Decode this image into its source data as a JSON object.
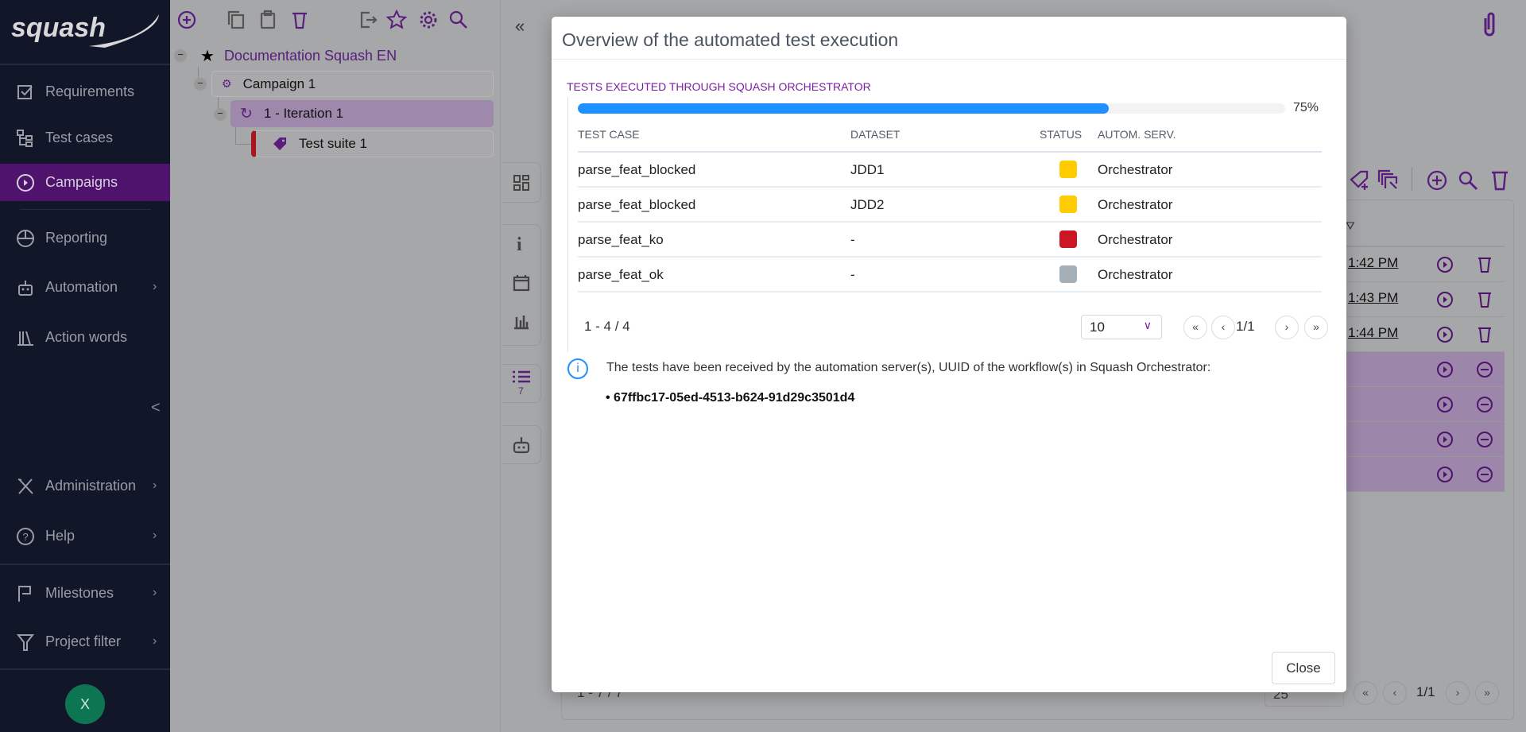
{
  "sidebar": {
    "logo": "squash",
    "items": [
      {
        "label": "Requirements",
        "icon": "checkbox-icon"
      },
      {
        "label": "Test cases",
        "icon": "tree-icon"
      },
      {
        "label": "Campaigns",
        "icon": "play-circle-icon",
        "active": true
      },
      {
        "label": "Reporting",
        "icon": "pie-chart-icon"
      },
      {
        "label": "Automation",
        "icon": "robot-icon",
        "has_submenu": true
      },
      {
        "label": "Action words",
        "icon": "library-icon"
      },
      {
        "label": "Administration",
        "icon": "tools-icon",
        "has_submenu": true
      },
      {
        "label": "Help",
        "icon": "help-icon",
        "has_submenu": true
      },
      {
        "label": "Milestones",
        "icon": "flag-icon",
        "has_submenu": true
      },
      {
        "label": "Project filter",
        "icon": "filter-icon",
        "has_submenu": true
      }
    ],
    "collapse": "<",
    "chevron": "›",
    "avatar": "X",
    "active_color": "#4f136d"
  },
  "tree": {
    "toolbar": [
      "add-icon",
      "copy-icon",
      "paste-icon",
      "delete-icon",
      "export-icon",
      "star-icon",
      "gear-icon",
      "search-icon"
    ],
    "nodes": [
      {
        "label": "Documentation Squash EN",
        "icon": "star-icon"
      },
      {
        "label": "Campaign 1",
        "icon": "gears-icon"
      },
      {
        "label": "1 - Iteration 1",
        "icon": "iteration-icon",
        "selected": true
      },
      {
        "label": "Test suite 1",
        "icon": "tag-icon"
      }
    ],
    "toggle": "−"
  },
  "background": {
    "collapse": "«",
    "tab_badge": "7",
    "times": [
      "1:42 PM",
      "1:43 PM",
      "1:44 PM"
    ],
    "pagination": {
      "count": "1 - 7 / 7",
      "page_size": "25",
      "page": "1/1",
      "first": "«",
      "prev": "‹",
      "next": "›",
      "last": "»"
    }
  },
  "modal": {
    "title": "Overview of the automated test execution",
    "section_label": "TESTS EXECUTED THROUGH SQUASH ORCHESTRATOR",
    "progress": 75,
    "progress_label": "75%",
    "progress_color": "#1e90ff",
    "columns": [
      "TEST CASE",
      "DATASET",
      "STATUS",
      "AUTOM. SERV."
    ],
    "rows": [
      {
        "test_case": "parse_feat_blocked",
        "dataset": "JDD1",
        "status": "blocked",
        "status_color": "#ffcc00",
        "server": "Orchestrator"
      },
      {
        "test_case": "parse_feat_blocked",
        "dataset": "JDD2",
        "status": "blocked",
        "status_color": "#ffcc00",
        "server": "Orchestrator"
      },
      {
        "test_case": "parse_feat_ko",
        "dataset": "-",
        "status": "failure",
        "status_color": "#cc1626",
        "server": "Orchestrator"
      },
      {
        "test_case": "parse_feat_ok",
        "dataset": "-",
        "status": "untestable",
        "status_color": "#a4afb7",
        "server": "Orchestrator"
      }
    ],
    "pagination": {
      "count": "1 - 4 / 4",
      "page_size": "10",
      "page": "1/1",
      "first": "«",
      "prev": "‹",
      "next": "›",
      "last": "»"
    },
    "info_icon": "i",
    "info_text": "The tests have been received by the automation server(s), UUID of the workflow(s) in Squash Orchestrator:",
    "uuids": [
      "67ffbc17-05ed-4513-b624-91d29c3501d4"
    ],
    "close_label": "Close"
  }
}
